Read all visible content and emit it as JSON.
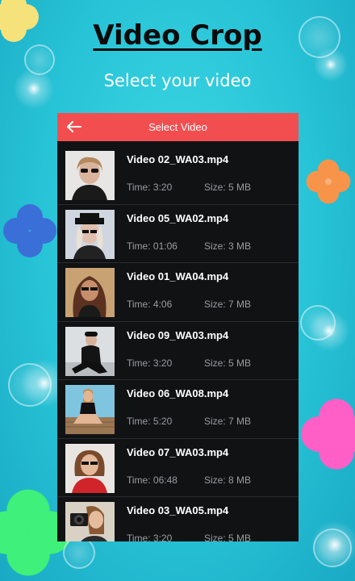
{
  "header": {
    "title": "Video Crop",
    "subtitle": "Select your video"
  },
  "panel": {
    "bar_title": "Select Video",
    "bar_color": "#f24e50"
  },
  "videos": [
    {
      "name": "Video 02_WA03.mp4",
      "time": "Time: 3:20",
      "size": "Size: 5 MB",
      "thumb": "woman-sunglasses-thumbnail"
    },
    {
      "name": "Video 05_WA02.mp4",
      "time": "Time: 01:06",
      "size": "Size: 3 MB",
      "thumb": "woman-hat-thumbnail"
    },
    {
      "name": "Video 01_WA04.mp4",
      "time": "Time: 4:06",
      "size": "Size: 7 MB",
      "thumb": "woman-curly-hair-thumbnail"
    },
    {
      "name": "Video 09_WA03.mp4",
      "time": "Time: 3:20",
      "size": "Size: 5 MB",
      "thumb": "woman-sitting-thumbnail"
    },
    {
      "name": "Video 06_WA08.mp4",
      "time": "Time: 5:20",
      "size": "Size: 7 MB",
      "thumb": "woman-pier-thumbnail"
    },
    {
      "name": "Video 07_WA03.mp4",
      "time": "Time: 06:48",
      "size": "Size: 8 MB",
      "thumb": "woman-red-top-thumbnail"
    },
    {
      "name": "Video 03_WA05.mp4",
      "time": "Time: 3:20",
      "size": "Size: 5 MB",
      "thumb": "woman-camera-thumbnail"
    }
  ]
}
